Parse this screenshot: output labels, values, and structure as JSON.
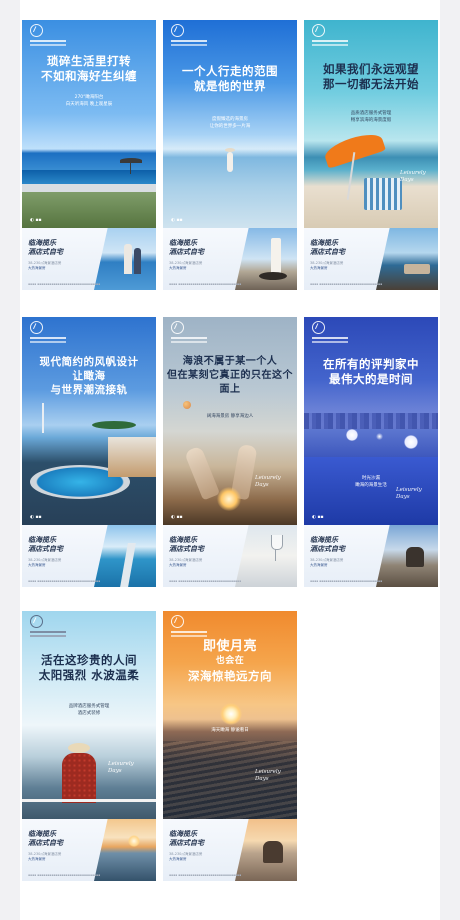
{
  "posters": [
    {
      "headline": [
        "琐碎生活里打转",
        "不如和海好生纠缠"
      ],
      "sub": [
        "270°瞰海阳台",
        "白天听海风 晚上观星辰"
      ],
      "signature": [
        "Leisurely",
        "Days"
      ]
    },
    {
      "headline": [
        "一个人行走的范围",
        "就是他的世界"
      ],
      "sub": [
        "度假臻选的海景房",
        "让你的世界多一片海"
      ],
      "signature": []
    },
    {
      "headline": [
        "如果我们永远观望",
        "那一切都无法开始"
      ],
      "sub": [
        "品质酒店服务式管理",
        "畅享滨海的海景度假"
      ],
      "signature": [
        "Leisurely",
        "Days"
      ]
    },
    {
      "headline": [
        "现代简约的风帆设计",
        "让瞰海",
        "与世界潮流接轨"
      ],
      "sub": [],
      "signature": []
    },
    {
      "headline": [
        "海浪不属于某一个人",
        "但在某刻它真正的只在这个面上"
      ],
      "sub": [
        "阔海海景房 静享海边人"
      ],
      "signature": [
        "Leisurely",
        "Days"
      ]
    },
    {
      "headline": [
        "在所有的评判家中",
        "最伟大的是时间"
      ],
      "sub": [
        "时光沙漏",
        "瞰海的海景生活"
      ],
      "signature": [
        "Leisurely",
        "Days"
      ]
    },
    {
      "headline": [
        "活在这珍贵的人间",
        "太阳强烈 水波温柔"
      ],
      "sub": [
        "品牌酒店服务式管理",
        "酒店式装修"
      ],
      "signature": [
        "Leisurely",
        "Days"
      ]
    },
    {
      "headline": [
        "即使月亮",
        "也会在",
        "深海惊艳远方向"
      ],
      "sub": [
        "海天瞰海 静谧看日"
      ],
      "signature": [
        "Leisurely",
        "Days"
      ]
    }
  ],
  "panel": {
    "title": [
      "临海揽乐",
      "酒店式自宅"
    ],
    "tags": [
      "38-230㎡海景酒店房",
      "大热海景房"
    ],
    "highlight": "大热海景房"
  },
  "colors": {
    "sheet_background": "#f1f1f3",
    "headline_dark": "#1c2f4f",
    "panel_title": "#24344f"
  },
  "icons": [
    "brand-logo-icon",
    "sun-icon",
    "umbrella-icon"
  ]
}
